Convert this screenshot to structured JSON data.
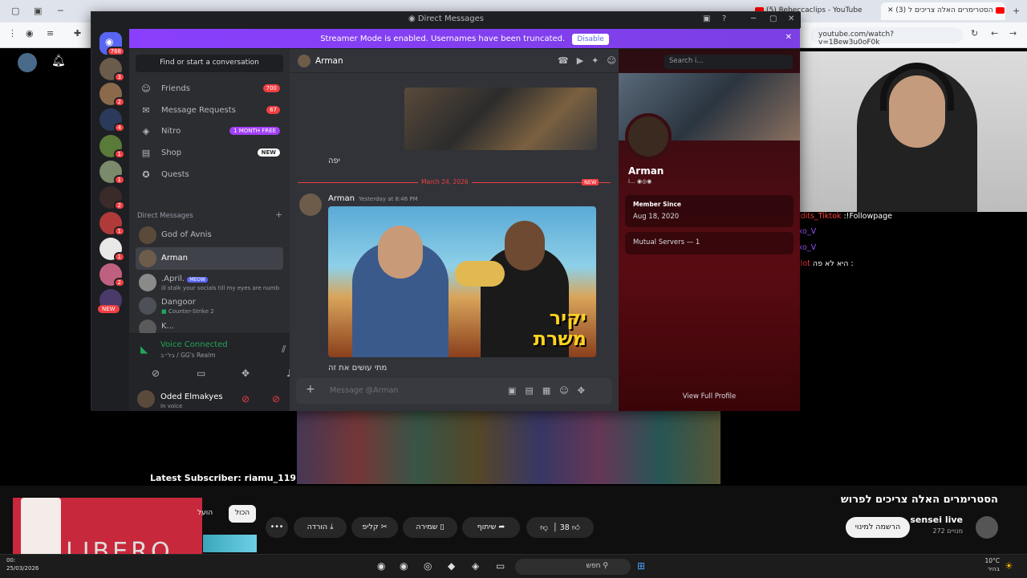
{
  "browser": {
    "tab_inactive": "(5) Rebeccaclips - YouTube",
    "tab_active": "(3) הסטרימרים האלה צריכים ל",
    "address": "youtube.com/watch?v=1Bew3u0oF0k"
  },
  "discord": {
    "window_title": "Direct Messages",
    "streamer_banner": "Streamer Mode is enabled. Usernames have been truncated.",
    "disable_label": "Disable",
    "home_badge": "768",
    "servers": [
      {
        "badge": "3",
        "color": "#6b5b4b"
      },
      {
        "badge": "2",
        "color": "#8a6a4a"
      },
      {
        "badge": "4",
        "color": "#2b3a5a"
      },
      {
        "badge": "1",
        "color": "#5a7a3a"
      },
      {
        "badge": "1",
        "color": "#7a8a6a"
      },
      {
        "badge": "2",
        "color": "#3a2a2a"
      },
      {
        "badge": "1",
        "color": "#b03a3a"
      },
      {
        "badge": "1",
        "color": "#e8e8e8"
      },
      {
        "badge": "2",
        "color": "#c06080"
      },
      {
        "badge": "NEW",
        "color": "#4a3a6a"
      }
    ],
    "search_conv": "Find or start a conversation",
    "nav": {
      "friends": "Friends",
      "friends_badge": "700",
      "requests": "Message Requests",
      "requests_badge": "67",
      "nitro": "Nitro",
      "nitro_pill": "1 MONTH FREE",
      "shop": "Shop",
      "shop_pill": "NEW",
      "quests": "Quests"
    },
    "dm_header": "Direct Messages",
    "dms": [
      {
        "name": "God of Avnis",
        "sub": "",
        "meow": ""
      },
      {
        "name": "Arman",
        "sub": "",
        "meow": ""
      },
      {
        "name": ".April.",
        "sub": "ill stalk your socials till my eyes are numb",
        "meow": "MEOW"
      },
      {
        "name": "Dangoor",
        "sub": "Counter-Strike 2",
        "meow": ""
      },
      {
        "name": "K...",
        "sub": "",
        "meow": ""
      }
    ],
    "voice": {
      "title": "Voice Connected",
      "channel": "בל״ב / GG's Realm",
      "user": "Oded Elmakyes",
      "status": "In voice"
    },
    "chat": {
      "recipient": "Arman",
      "msg1": "יפה",
      "date_divider": "March 24, 2026",
      "new_label": "NEW",
      "author": "Arman",
      "time": "Yesterday at 8:46 PM",
      "image_text_line1": "יקיר",
      "image_text_line2": "משרת",
      "msg2": "מתי עושים את זה",
      "input_placeholder": "Message @Arman"
    },
    "profile": {
      "search_placeholder": "Search i...",
      "name": "Arman",
      "tags": "i...",
      "member_since_label": "Member Since",
      "member_since": "Aug 18, 2020",
      "mutual": "Mutual Servers — 1",
      "view_full": "View Full Profile"
    }
  },
  "stream_overlay": {
    "chat_lines": [
      {
        "user": "5sxEdits_Tiktok",
        "text": ":!Followpage",
        "color": "#ff3b3b"
      },
      {
        "user": "alexxo_V",
        "text": "",
        "color": "#9b59ff"
      },
      {
        "user": "alexxo_V",
        "text": "",
        "color": "#9b59ff"
      },
      {
        "user": "Pilpelot",
        "text": "היא לא פה :",
        "color": "#ff3b3b"
      }
    ],
    "latest_subscriber": "Latest Subscriber: riamu_119"
  },
  "youtube": {
    "video_title": "הסטרימרים האלה צריכים לפרוש",
    "channel": "sensei live",
    "subs": "272 מנויים",
    "subscribe": "הרשמה למינוי",
    "likes": "38",
    "share": "שיתוף",
    "save": "שמירה",
    "clip": "קליפ",
    "download": "הורדה",
    "filter_all": "הכול",
    "filter_2": "הועל",
    "ad_text": "LIBERO"
  },
  "taskbar": {
    "search": "חפש",
    "time": "00:",
    "date": "25/03/2026",
    "temp": "10°C",
    "weather": "בהיר"
  },
  "colors": {
    "discord_bg": "#313338",
    "discord_sidebar": "#2b2d31",
    "streamer_banner": "#8a3ffc",
    "notification_red": "#f23f43",
    "online_green": "#23a55a"
  }
}
